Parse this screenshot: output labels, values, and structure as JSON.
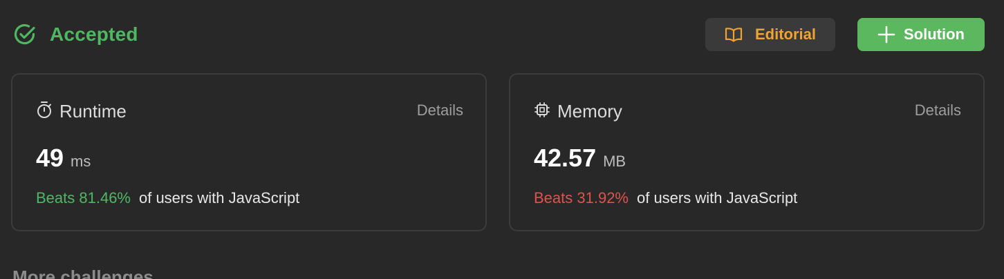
{
  "status": {
    "label": "Accepted",
    "color": "#4fb863",
    "icon": "check-circle-icon"
  },
  "actions": {
    "editorial": {
      "label": "Editorial",
      "icon": "book-open-icon",
      "color": "#f0a232"
    },
    "solution": {
      "label": "Solution",
      "icon": "plus-icon",
      "color": "#5cb85f"
    }
  },
  "runtime": {
    "title": "Runtime",
    "icon": "stopwatch-icon",
    "details": "Details",
    "value": "49",
    "unit": "ms",
    "beats": "Beats 81.46%",
    "beats_color": "#4fb863",
    "suffix": "of users with JavaScript"
  },
  "memory": {
    "title": "Memory",
    "icon": "chip-icon",
    "details": "Details",
    "value": "42.57",
    "unit": "MB",
    "beats": "Beats 31.92%",
    "beats_color": "#e0534d",
    "suffix": "of users with JavaScript"
  },
  "more": {
    "label": "More challenges"
  }
}
